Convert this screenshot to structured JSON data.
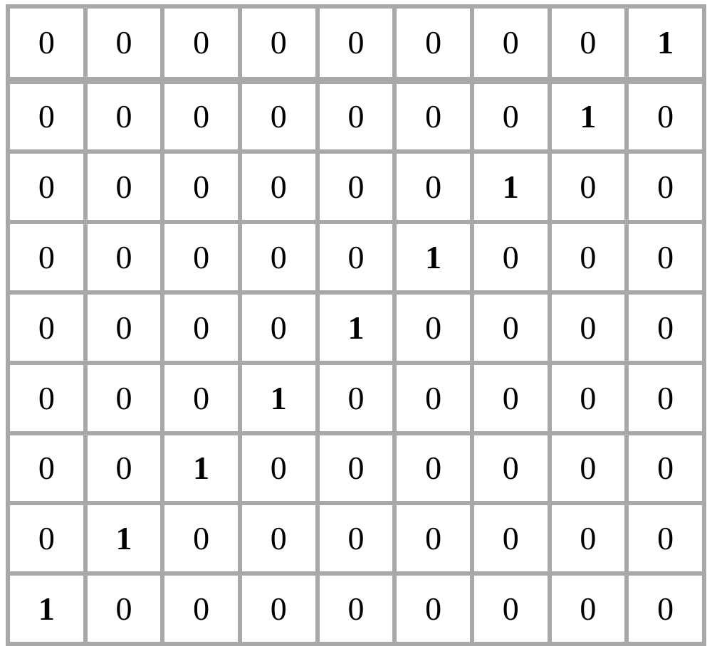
{
  "chart_data": {
    "type": "table",
    "title": "",
    "rows": 9,
    "cols": 9,
    "values": [
      [
        0,
        0,
        0,
        0,
        0,
        0,
        0,
        0,
        1
      ],
      [
        0,
        0,
        0,
        0,
        0,
        0,
        0,
        1,
        0
      ],
      [
        0,
        0,
        0,
        0,
        0,
        0,
        1,
        0,
        0
      ],
      [
        0,
        0,
        0,
        0,
        0,
        1,
        0,
        0,
        0
      ],
      [
        0,
        0,
        0,
        0,
        1,
        0,
        0,
        0,
        0
      ],
      [
        0,
        0,
        0,
        1,
        0,
        0,
        0,
        0,
        0
      ],
      [
        0,
        0,
        1,
        0,
        0,
        0,
        0,
        0,
        0
      ],
      [
        0,
        1,
        0,
        0,
        0,
        0,
        0,
        0,
        0
      ],
      [
        1,
        0,
        0,
        0,
        0,
        0,
        0,
        0,
        0
      ]
    ]
  },
  "style": {
    "grid_color": "#a8a8a8",
    "cell_bg": "#ffffff",
    "text_color": "#000000",
    "one_bold": true
  }
}
